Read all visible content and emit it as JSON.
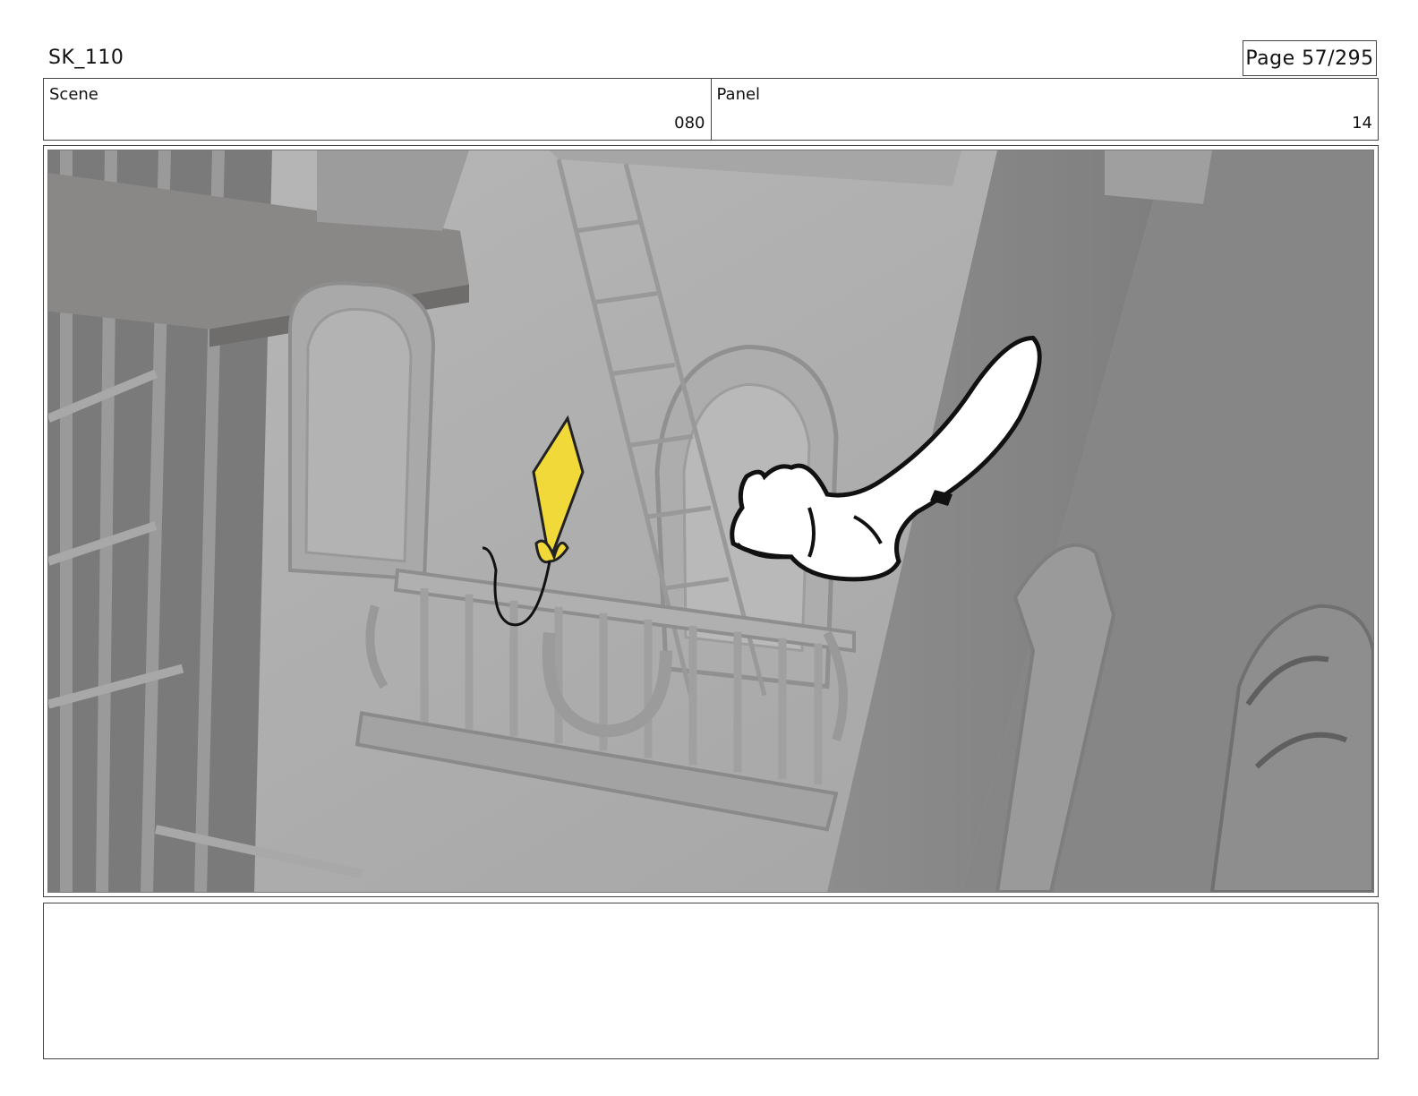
{
  "header": {
    "sheet_id": "SK_110",
    "page_label": "Page",
    "page": "57/295"
  },
  "info": {
    "scene_label": "Scene",
    "scene_value": "080",
    "panel_label": "Panel",
    "panel_value": "14"
  },
  "colors": {
    "kite": "#f2d93a",
    "creature": "#ffffff",
    "ink": "#111111"
  },
  "notes": {
    "text": ""
  }
}
